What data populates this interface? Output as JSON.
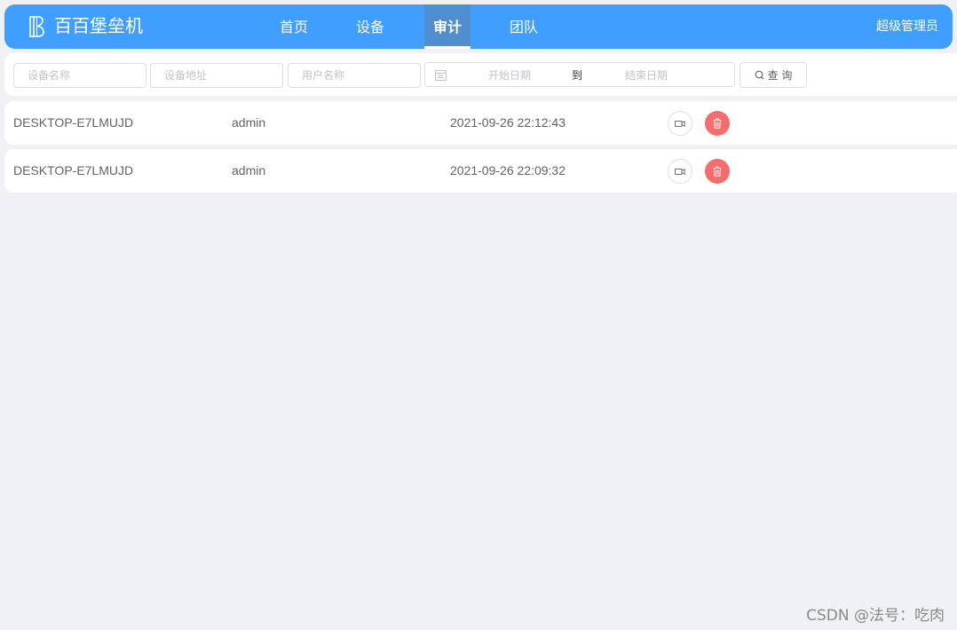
{
  "app": {
    "title": "百百堡垒机",
    "logo_icon": "logo-b-icon",
    "accent_color": "#409eff"
  },
  "nav": {
    "items": [
      {
        "label": "首页",
        "active": false
      },
      {
        "label": "设备",
        "active": false
      },
      {
        "label": "审计",
        "active": true
      },
      {
        "label": "团队",
        "active": false
      }
    ]
  },
  "user": {
    "name": "超级管理员"
  },
  "filters": {
    "device_name_placeholder": "设备名称",
    "device_address_placeholder": "设备地址",
    "user_name_placeholder": "用户名称",
    "start_date_placeholder": "开始日期",
    "range_separator": "到",
    "end_date_placeholder": "结束日期",
    "search_label": "查 询",
    "calendar_icon": "calendar-icon",
    "search_icon": "search-icon"
  },
  "records": [
    {
      "device": "DESKTOP-E7LMUJD",
      "user": "admin",
      "time": "2021-09-26 22:12:43"
    },
    {
      "device": "DESKTOP-E7LMUJD",
      "user": "admin",
      "time": "2021-09-26 22:09:32"
    }
  ],
  "row_actions": {
    "video_icon": "video-camera-icon",
    "delete_icon": "trash-icon",
    "delete_color": "#f56c6c"
  },
  "watermark": "CSDN @法号：吃肉"
}
